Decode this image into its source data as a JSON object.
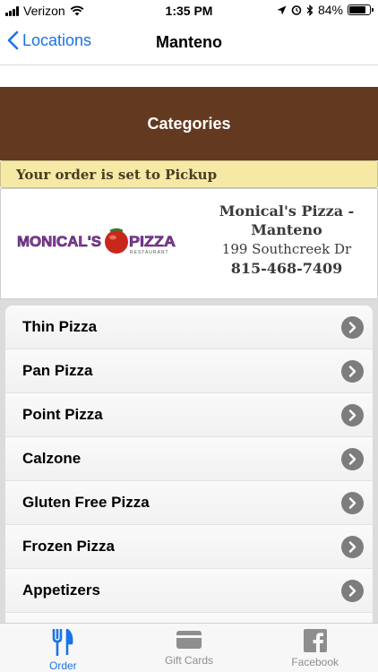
{
  "status_bar": {
    "carrier": "Verizon",
    "time": "1:35 PM",
    "battery": "84%",
    "battery_level": 0.84
  },
  "nav": {
    "back_label": "Locations",
    "title": "Manteno"
  },
  "header": {
    "title": "Categories"
  },
  "banner": {
    "text": "Your order is set to Pickup"
  },
  "store": {
    "logo_text": "MONICAL'S PIZZA",
    "logo_subtext": "RESTAURANT",
    "name": "Monical's Pizza - Manteno",
    "address": "199 Southcreek Dr",
    "phone": "815-468-7409"
  },
  "categories": [
    {
      "label": "Thin Pizza"
    },
    {
      "label": "Pan Pizza"
    },
    {
      "label": "Point Pizza"
    },
    {
      "label": "Calzone"
    },
    {
      "label": "Gluten Free Pizza"
    },
    {
      "label": "Frozen Pizza"
    },
    {
      "label": "Appetizers"
    },
    {
      "label": ""
    }
  ],
  "tabs": [
    {
      "label": "Order",
      "icon": "fork-knife-icon",
      "active": true
    },
    {
      "label": "Gift Cards",
      "icon": "gift-card-icon",
      "active": false
    },
    {
      "label": "Facebook",
      "icon": "facebook-icon",
      "active": false
    }
  ],
  "colors": {
    "accent": "#1a73e8",
    "header_bg": "#633a1f",
    "banner_bg": "#f6e9a6"
  }
}
